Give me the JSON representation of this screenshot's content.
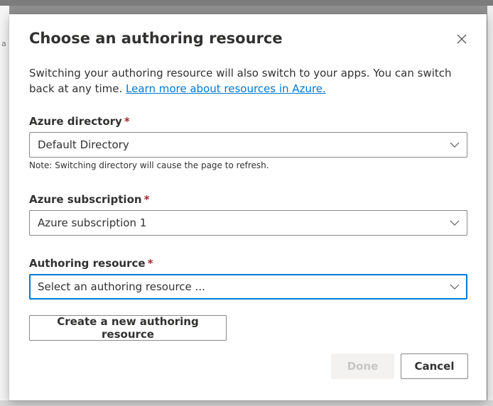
{
  "dialog": {
    "title": "Choose an authoring resource",
    "close_icon": "close-icon",
    "intro_text": "Switching your authoring resource will also switch to your apps. You can switch back at any time. ",
    "learn_more_link": "Learn more about resources in Azure."
  },
  "fields": {
    "directory": {
      "label": "Azure directory",
      "required_mark": "*",
      "value": "Default Directory",
      "note": "Note: Switching directory will cause the page to refresh."
    },
    "subscription": {
      "label": "Azure subscription",
      "required_mark": "*",
      "value": "Azure subscription 1"
    },
    "resource": {
      "label": "Authoring resource",
      "required_mark": "*",
      "value": "Select an authoring resource ..."
    }
  },
  "buttons": {
    "create": "Create a new authoring resource",
    "done": "Done",
    "cancel": "Cancel"
  },
  "colors": {
    "accent": "#0078d4",
    "required": "#a4262c",
    "text": "#323130",
    "disabled_bg": "#f3f2f1",
    "disabled_text": "#c8c6c4"
  }
}
